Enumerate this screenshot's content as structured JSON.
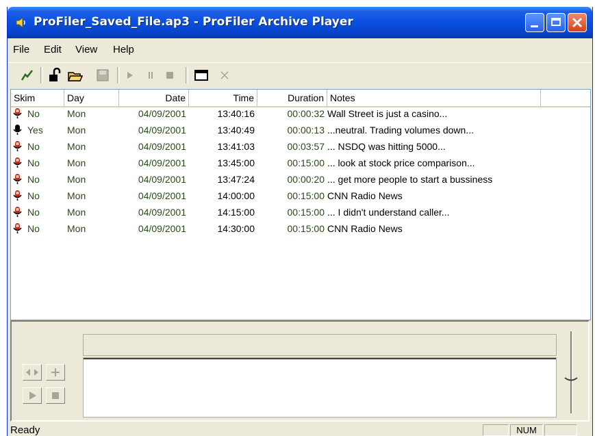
{
  "window": {
    "title": "ProFiler_Saved_File.ap3 - ProFiler Archive Player"
  },
  "menu": [
    "File",
    "Edit",
    "View",
    "Help"
  ],
  "columns": [
    "Skim",
    "Day",
    "Date",
    "Time",
    "Duration",
    "Notes"
  ],
  "rows": [
    {
      "skim": "No",
      "day": "Mon",
      "date": "04/09/2001",
      "time": "13:40:16",
      "duration": "00:00:32",
      "notes": "Wall Street is just a casino..."
    },
    {
      "skim": "Yes",
      "day": "Mon",
      "date": "04/09/2001",
      "time": "13:40:49",
      "duration": "00:00:13",
      "notes": "...neutral.  Trading volumes down..."
    },
    {
      "skim": "No",
      "day": "Mon",
      "date": "04/09/2001",
      "time": "13:41:03",
      "duration": "00:03:57",
      "notes": "... NSDQ was hitting 5000..."
    },
    {
      "skim": "No",
      "day": "Mon",
      "date": "04/09/2001",
      "time": "13:45:00",
      "duration": "00:15:00",
      "notes": "... look at stock price comparison..."
    },
    {
      "skim": "No",
      "day": "Mon",
      "date": "04/09/2001",
      "time": "13:47:24",
      "duration": "00:00:20",
      "notes": "... get more people to start a bussiness"
    },
    {
      "skim": "No",
      "day": "Mon",
      "date": "04/09/2001",
      "time": "14:00:00",
      "duration": "00:15:00",
      "notes": "CNN Radio News"
    },
    {
      "skim": "No",
      "day": "Mon",
      "date": "04/09/2001",
      "time": "14:15:00",
      "duration": "00:15:00",
      "notes": "... I didn't understand caller..."
    },
    {
      "skim": "No",
      "day": "Mon",
      "date": "04/09/2001",
      "time": "14:30:00",
      "duration": "00:15:00",
      "notes": "CNN Radio News"
    }
  ],
  "status": {
    "text": "Ready",
    "num": "NUM"
  },
  "icons": {
    "title": "speaker-icon",
    "toolbar": [
      "pen-icon",
      "unlock-icon",
      "open-folder-icon",
      "save-icon",
      "play-icon",
      "pause-icon",
      "stop-icon",
      "window-icon",
      "close-x-icon"
    ],
    "mic_no": "red-mic-icon",
    "mic_yes": "black-mic-icon"
  },
  "colors": {
    "title_bar": "#0a4fe0",
    "row_text": "#2a4a1a",
    "accent_red": "#c0261e"
  }
}
